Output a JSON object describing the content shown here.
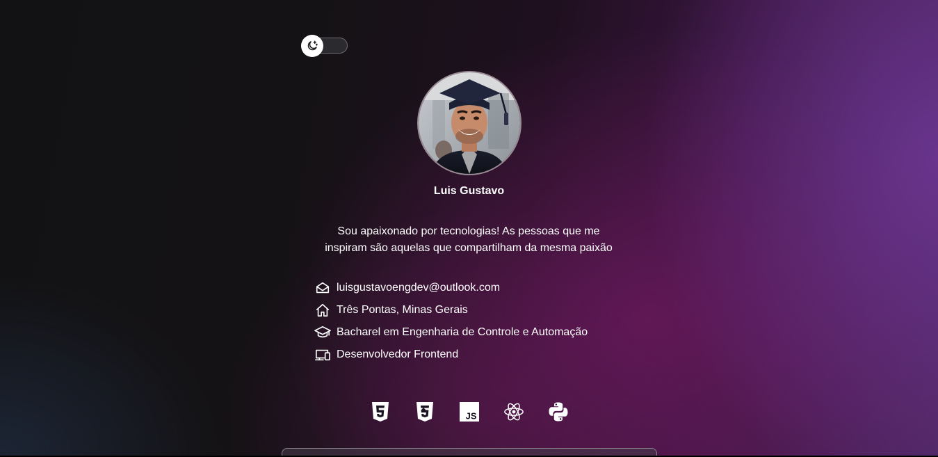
{
  "theme_toggle": {
    "icon": "moon-stars-icon",
    "state": "dark"
  },
  "profile": {
    "avatar_icon": "profile-photo",
    "name": "Luis Gustavo",
    "bio_line1": "Sou apaixonado por tecnologias! As pessoas que me",
    "bio_line2": "inspiram são aquelas que compartilham da mesma paixão"
  },
  "info": [
    {
      "icon": "envelope-icon",
      "text": "luisgustavoengdev@outlook.com"
    },
    {
      "icon": "house-icon",
      "text": "Três Pontas, Minas Gerais"
    },
    {
      "icon": "graduation-cap-icon",
      "text": "Bacharel em Engenharia de Controle e Automação"
    },
    {
      "icon": "devices-icon",
      "text": "Desenvolvedor Frontend"
    }
  ],
  "technologies": [
    {
      "icon": "html5-icon"
    },
    {
      "icon": "css3-icon"
    },
    {
      "icon": "javascript-icon"
    },
    {
      "icon": "react-icon"
    },
    {
      "icon": "python-icon"
    }
  ],
  "colors": {
    "text": "#ffffff",
    "accent_purple": "#5e3278",
    "accent_magenta": "#5a1a52"
  }
}
